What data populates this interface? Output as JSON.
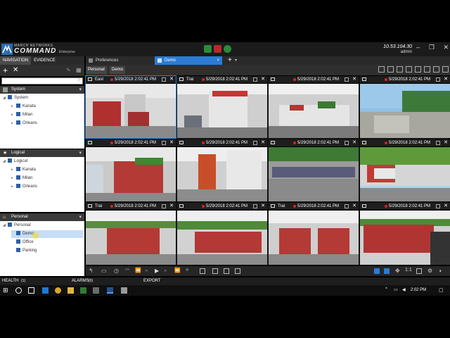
{
  "app": {
    "brand_top": "MARCH NETWORKS",
    "brand_main": "COMMAND",
    "brand_sub": "Enterprise",
    "server_ip": "10.53.104.30",
    "user": "admin"
  },
  "nav": {
    "tabs": [
      "NAVIGATION",
      "EVIDENCE"
    ],
    "sections": [
      {
        "title": "System",
        "root": "System",
        "children": [
          "Kanata",
          "Milan",
          "Orleans"
        ]
      },
      {
        "title": "Logical",
        "root": "Logical",
        "children": [
          "Kanata",
          "Milan",
          "Orleans"
        ]
      },
      {
        "title": "Personal",
        "root": "Personal",
        "children": [
          "Demo",
          "Office",
          "Parking"
        ]
      }
    ]
  },
  "workspace": {
    "tabs": [
      "Preferences",
      "Demo"
    ],
    "breadcrumb": [
      "Personal",
      "Demo"
    ]
  },
  "tiles": [
    {
      "name": "East",
      "time": "5/29/2018 2:02:41 PM"
    },
    {
      "name": "Trai",
      "time": "5/29/2018 2:02:41 PM"
    },
    {
      "name": "",
      "time": "5/29/2018 2:02:41 PM"
    },
    {
      "name": "",
      "time": "5/29/2018 2:02:41 PM"
    },
    {
      "name": "",
      "time": "5/29/2018 2:02:41 PM"
    },
    {
      "name": "",
      "time": "5/29/2018 2:02:41 PM"
    },
    {
      "name": "",
      "time": "5/29/2018 2:02:41 PM"
    },
    {
      "name": "",
      "time": "5/29/2018 2:02:41 PM"
    },
    {
      "name": "Trai",
      "time": "5/29/2018 2:02:41 PM"
    },
    {
      "name": "",
      "time": "5/29/2018 2:02:41 PM"
    },
    {
      "name": "Trai",
      "time": "5/29/2018 2:02:41 PM"
    },
    {
      "name": "",
      "time": "5/29/2018 2:02:41 PM"
    }
  ],
  "bottom": {
    "ratio": "1:1"
  },
  "status": {
    "health": "HEALTH",
    "health_count": "(1)",
    "alarms": "ALARMS",
    "alarms_count": "(0)",
    "export": "EXPORT"
  },
  "taskbar": {
    "time": "2:02 PM"
  },
  "icons": {
    "add": "plus-icon",
    "remove": "close-icon",
    "filter": "filter-icon",
    "camera": "camera-icon"
  },
  "colors": {
    "accent": "#2c7bd4",
    "recording": "#e02020"
  }
}
